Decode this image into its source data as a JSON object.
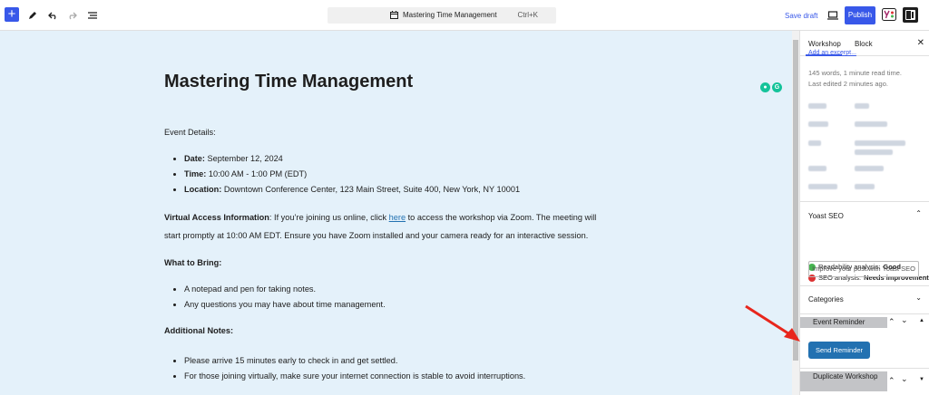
{
  "toolbar": {
    "document_title": "Mastering Time Management",
    "shortcut": "Ctrl+K",
    "save_draft": "Save draft",
    "publish": "Publish"
  },
  "editor": {
    "title": "Mastering Time Management",
    "event_details_label": "Event Details:",
    "details": [
      {
        "label": "Date:",
        "value": " September 12, 2024"
      },
      {
        "label": "Time:",
        "value": " 10:00 AM - 1:00 PM (EDT)"
      },
      {
        "label": "Location:",
        "value": " Downtown Conference Center, 123 Main Street, Suite 400, New York, NY 10001"
      }
    ],
    "virtual_label": "Virtual Access Information",
    "virtual_text_1": ": If you’re joining us online, click ",
    "virtual_link": "here",
    "virtual_text_2": " to access the workshop via Zoom. The meeting will start promptly at 10:00 AM EDT. Ensure you have Zoom installed and your camera ready for an interactive session.",
    "bring_label": "What to Bring:",
    "bring_items": [
      "A notepad and pen for taking notes.",
      "Any questions you may have about time management."
    ],
    "notes_label": "Additional Notes:",
    "notes_items": [
      "Please arrive 15 minutes early to check in and get settled.",
      "For those joining virtually, make sure your internet connection is stable to avoid interruptions."
    ]
  },
  "sidebar": {
    "tab_workshop": "Workshop",
    "tab_block": "Block",
    "excerpt_link": "Add an excerpt...",
    "word_count": "145 words, 1 minute read time.",
    "last_edited": "Last edited 2 minutes ago.",
    "yoast_title": "Yoast SEO",
    "readability_label": "Readability analysis:",
    "readability_value": "Good",
    "seo_label": "SEO analysis:",
    "seo_value": "Needs improvement",
    "improve_button": "Improve your post with Yoast SEO",
    "categories_title": "Categories",
    "event_reminder_title": "Event Reminder",
    "send_reminder": "Send Reminder",
    "duplicate_title": "Duplicate Workshop"
  },
  "colors": {
    "accent": "#3858e9",
    "canvas_bg": "#e4f1fa",
    "send_button": "#2271b1",
    "arrow": "#e8261c",
    "good": "#46b450",
    "bad": "#dc3232"
  }
}
